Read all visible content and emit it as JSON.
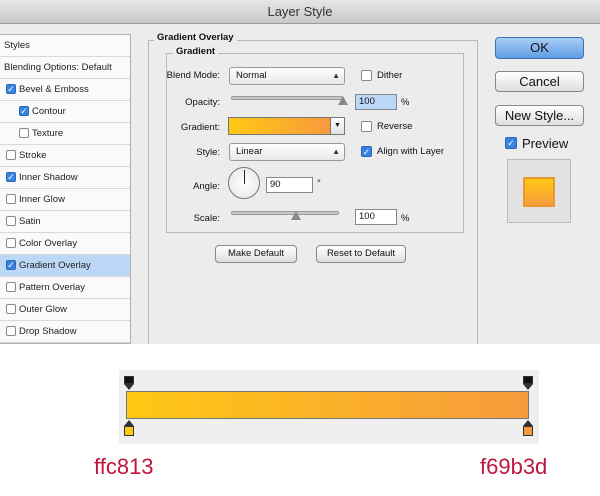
{
  "window": {
    "title": "Layer Style"
  },
  "styles_panel": {
    "items": [
      {
        "label": "Styles",
        "checkbox": false,
        "checked": false,
        "indent": false,
        "selected": false
      },
      {
        "label": "Blending Options: Default",
        "checkbox": false,
        "checked": false,
        "indent": false,
        "selected": false
      },
      {
        "label": "Bevel & Emboss",
        "checkbox": true,
        "checked": true,
        "indent": false,
        "selected": false
      },
      {
        "label": "Contour",
        "checkbox": true,
        "checked": true,
        "indent": true,
        "selected": false
      },
      {
        "label": "Texture",
        "checkbox": true,
        "checked": false,
        "indent": true,
        "selected": false
      },
      {
        "label": "Stroke",
        "checkbox": true,
        "checked": false,
        "indent": false,
        "selected": false
      },
      {
        "label": "Inner Shadow",
        "checkbox": true,
        "checked": true,
        "indent": false,
        "selected": false
      },
      {
        "label": "Inner Glow",
        "checkbox": true,
        "checked": false,
        "indent": false,
        "selected": false
      },
      {
        "label": "Satin",
        "checkbox": true,
        "checked": false,
        "indent": false,
        "selected": false
      },
      {
        "label": "Color Overlay",
        "checkbox": true,
        "checked": false,
        "indent": false,
        "selected": false
      },
      {
        "label": "Gradient Overlay",
        "checkbox": true,
        "checked": true,
        "indent": false,
        "selected": true
      },
      {
        "label": "Pattern Overlay",
        "checkbox": true,
        "checked": false,
        "indent": false,
        "selected": false
      },
      {
        "label": "Outer Glow",
        "checkbox": true,
        "checked": false,
        "indent": false,
        "selected": false
      },
      {
        "label": "Drop Shadow",
        "checkbox": true,
        "checked": false,
        "indent": false,
        "selected": false
      }
    ]
  },
  "gradient_overlay": {
    "group_title": "Gradient Overlay",
    "subgroup_title": "Gradient",
    "blend_mode": {
      "label": "Blend Mode:",
      "value": "Normal"
    },
    "dither": {
      "label": "Dither",
      "checked": false
    },
    "opacity": {
      "label": "Opacity:",
      "value": "100",
      "unit": "%",
      "slider_fraction": 1.0
    },
    "gradient": {
      "label": "Gradient:"
    },
    "reverse": {
      "label": "Reverse",
      "checked": false
    },
    "style": {
      "label": "Style:",
      "value": "Linear"
    },
    "align_with_layer": {
      "label": "Align with Layer",
      "checked": true
    },
    "angle": {
      "label": "Angle:",
      "value": "90",
      "unit": "°"
    },
    "scale": {
      "label": "Scale:",
      "value": "100",
      "unit": "%",
      "slider_fraction": 0.6
    },
    "make_default_label": "Make Default",
    "reset_default_label": "Reset to Default"
  },
  "buttons": {
    "ok_label": "OK",
    "cancel_label": "Cancel",
    "new_style_label": "New Style...",
    "preview_label": "Preview",
    "preview_checked": true
  },
  "gradient_editor": {
    "start_label": "ffc813",
    "end_label": "f69b3d"
  },
  "colors": {
    "gradient_start": "#ffc813",
    "gradient_end": "#f69b3d",
    "label_text": "#c0143c",
    "selection": "#bcd8f6",
    "accent": "#3a82e0"
  },
  "icons": [
    "checkmark-icon",
    "dropdown-arrow-icon",
    "angle-dial-icon",
    "slider-thumb-icon",
    "color-stop-icon",
    "opacity-stop-icon"
  ]
}
